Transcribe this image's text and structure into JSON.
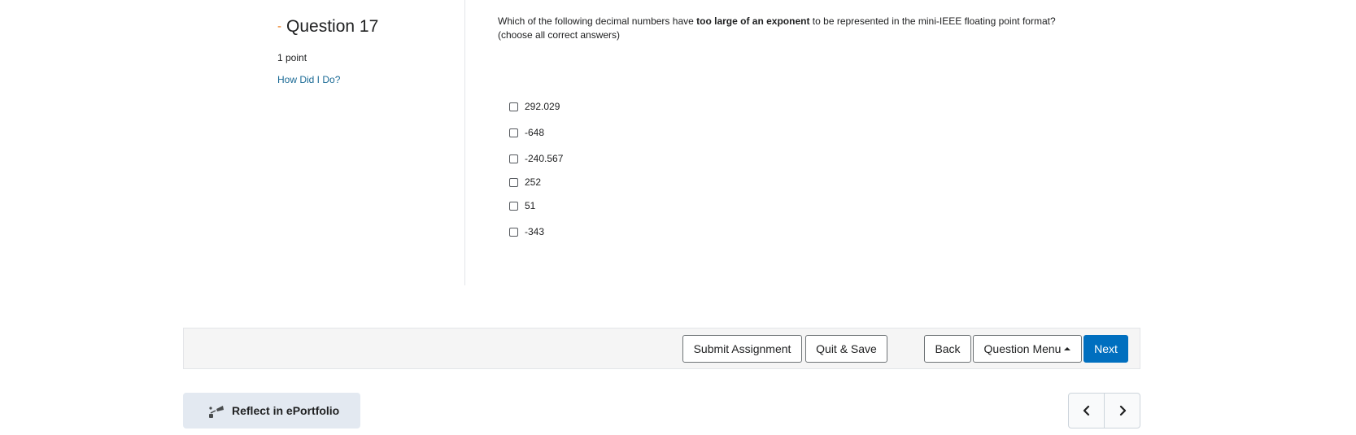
{
  "question": {
    "title": "Question 17",
    "points": "1 point",
    "how_did_i_do": "How Did I Do?",
    "prompt_before": "Which of the following decimal numbers have ",
    "prompt_bold": "too large of an exponent",
    "prompt_after": " to be represented in the mini-IEEE floating point format?",
    "prompt_line2": "(choose all correct answers)",
    "options": [
      {
        "label": "292.029",
        "checked": false
      },
      {
        "label": "-648",
        "checked": false
      },
      {
        "label": "-240.567",
        "checked": false
      },
      {
        "label": "252",
        "checked": false
      },
      {
        "label": "51",
        "checked": false
      },
      {
        "label": "-343",
        "checked": false
      }
    ]
  },
  "toolbar": {
    "submit_label": "Submit Assignment",
    "quit_save_label": "Quit & Save",
    "back_label": "Back",
    "question_menu_label": "Question Menu",
    "next_label": "Next"
  },
  "footer": {
    "reflect_label": "Reflect in ePortfolio",
    "prev_icon": "chevron-left-icon",
    "next_icon": "chevron-right-icon"
  },
  "colors": {
    "primary": "#006fbf",
    "link": "#1a6a95",
    "accent_dash": "#e87511"
  }
}
